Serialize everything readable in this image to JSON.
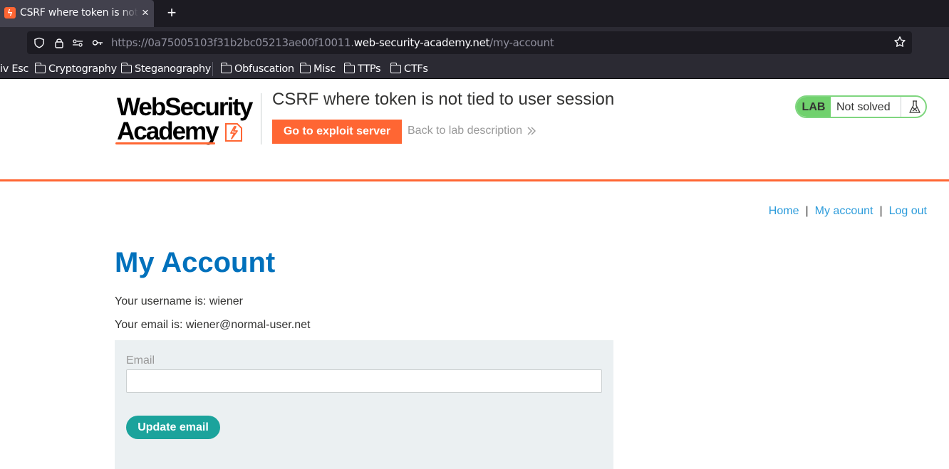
{
  "browser": {
    "tab": {
      "title": "CSRF where token is not tied to user session",
      "favicon": "web-security-academy-icon"
    },
    "new_tab_symbol": "+",
    "url": {
      "prefix": "https://0a75005103f31b2bc05213ae00f10011.",
      "domain": "web-security-academy.net",
      "path": "/my-account"
    },
    "bookmarks": [
      "iv Esc",
      "Cryptography",
      "Steganography",
      "Obfuscation",
      "Misc",
      "TTPs",
      "CTFs"
    ]
  },
  "header": {
    "logo_line1": "WebSecurity",
    "logo_line2": "Academy",
    "lab_title": "CSRF where token is not tied to user session",
    "exploit_button": "Go to exploit server",
    "back_link": "Back to lab description",
    "lab_badge": "LAB",
    "lab_state": "Not solved"
  },
  "nav": {
    "home": "Home",
    "separator": "|",
    "my_account": "My account",
    "logout": "Log out"
  },
  "main": {
    "heading": "My Account",
    "username_line": "Your username is: wiener",
    "email_line": "Your email is: wiener@normal-user.net",
    "form": {
      "email_label": "Email",
      "email_value": "",
      "email_placeholder": "",
      "submit": "Update email"
    }
  },
  "colors": {
    "accent": "#ff6633",
    "link": "#2d9cdb",
    "heading": "#0071bc",
    "lab_badge": "#70d16d",
    "button": "#1ba39c",
    "form_bg": "#ebf0f2"
  }
}
